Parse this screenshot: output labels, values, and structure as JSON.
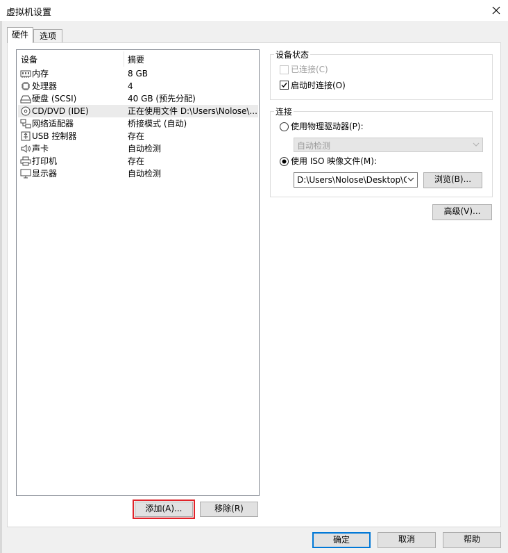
{
  "window": {
    "title": "虚拟机设置"
  },
  "tabs": [
    {
      "label": "硬件",
      "selected": true
    },
    {
      "label": "选项",
      "selected": false
    }
  ],
  "device_list": {
    "columns": {
      "device": "设备",
      "summary": "摘要"
    },
    "rows": [
      {
        "icon": "memory-icon",
        "name": "内存",
        "summary": "8 GB"
      },
      {
        "icon": "processor-icon",
        "name": "处理器",
        "summary": "4"
      },
      {
        "icon": "hard-disk-icon",
        "name": "硬盘 (SCSI)",
        "summary": "40 GB (预先分配)"
      },
      {
        "icon": "cd-dvd-icon",
        "name": "CD/DVD (IDE)",
        "summary": "正在使用文件 D:\\Users\\Nolose\\...",
        "selected": true
      },
      {
        "icon": "network-adapter-icon",
        "name": "网络适配器",
        "summary": "桥接模式 (自动)"
      },
      {
        "icon": "usb-icon",
        "name": "USB 控制器",
        "summary": "存在"
      },
      {
        "icon": "sound-card-icon",
        "name": "声卡",
        "summary": "自动检测"
      },
      {
        "icon": "printer-icon",
        "name": "打印机",
        "summary": "存在"
      },
      {
        "icon": "display-icon",
        "name": "显示器",
        "summary": "自动检测"
      }
    ]
  },
  "list_buttons": {
    "add": "添加(A)...",
    "remove": "移除(R)"
  },
  "device_status": {
    "title": "设备状态",
    "connected": {
      "label": "已连接(C)",
      "checked": false,
      "enabled": false
    },
    "connect_at_power_on": {
      "label": "启动时连接(O)",
      "checked": true,
      "enabled": true
    }
  },
  "connection": {
    "title": "连接",
    "physical_drive": {
      "label": "使用物理驱动器(P):",
      "selected": false,
      "value": "自动检测"
    },
    "iso_image": {
      "label": "使用 ISO 映像文件(M):",
      "selected": true,
      "value": "D:\\Users\\Nolose\\Desktop\\Ce"
    },
    "browse": "浏览(B)..."
  },
  "advanced_button": "高级(V)...",
  "dialog_buttons": {
    "ok": "确定",
    "cancel": "取消",
    "help": "帮助"
  },
  "colors": {
    "highlight_box": "#e0242a",
    "default_button_border": "#0078d7"
  }
}
